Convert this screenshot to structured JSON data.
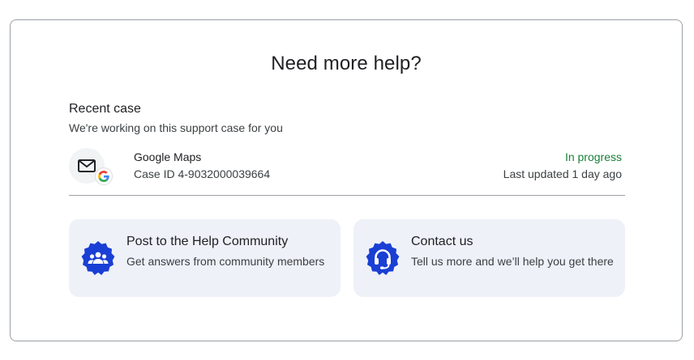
{
  "help": {
    "title": "Need more help?",
    "recent_case": {
      "heading": "Recent case",
      "subtitle": "We're working on this support case for you",
      "product": "Google Maps",
      "case_id": "Case ID 4-9032000039664",
      "status": "In progress",
      "last_updated": "Last updated 1 day ago",
      "icons": [
        "mail-icon",
        "google-logo-icon"
      ]
    },
    "options": [
      {
        "title": "Post to the Help Community",
        "description": "Get answers from community members",
        "icon": "community-icon"
      },
      {
        "title": "Contact us",
        "description": "Tell us more and we’ll help you get there",
        "icon": "headset-icon"
      }
    ],
    "colors": {
      "status_green": "#188038",
      "card_bg": "#eef1f8",
      "icon_blue": "#1a3fd4"
    }
  }
}
